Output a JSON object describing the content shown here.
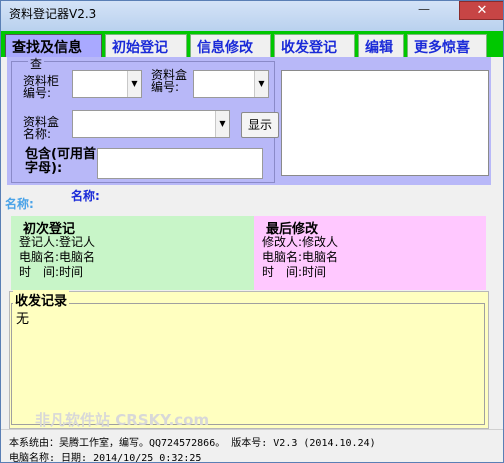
{
  "window": {
    "title": "资料登记器V2.3",
    "min_glyph": "—",
    "close_glyph": "✕"
  },
  "tabs": [
    {
      "label": "查找及信息",
      "active": true
    },
    {
      "label": "初始登记",
      "active": false
    },
    {
      "label": "信息修改",
      "active": false
    },
    {
      "label": "收发登记",
      "active": false
    },
    {
      "label": "编辑",
      "active": false
    },
    {
      "label": "更多惊喜",
      "active": false
    }
  ],
  "query": {
    "legend": "查",
    "cabinet_label_1": "资料柜",
    "cabinet_label_2": "编号:",
    "box_no_label_1": "资料盒",
    "box_no_label_2": "编号:",
    "box_name_label_1": "资料盒",
    "box_name_label_2": "名称:",
    "show_button": "显示",
    "keyword_label": "包含(可用首字母):",
    "keyword_value": ""
  },
  "name_label": "名称:",
  "name_label_left": "名称:",
  "first_registration": {
    "title": "初次登记",
    "registrar": "登记人:登记人",
    "computer": "电脑名:电脑名",
    "time": "时　间:时间"
  },
  "last_modification": {
    "title": "最后修改",
    "modifier": "修改人:修改人",
    "computer": "电脑名:电脑名",
    "time": "时　间:时间"
  },
  "log": {
    "title": "收发记录",
    "content": "无"
  },
  "status": {
    "line1": "本系统由：吴腾工作室，编写。QQ724572866。      版本号: V2.3   (2014.10.24)",
    "line2": "电脑名称:                          日期:        2014/10/25 0:32:25"
  },
  "watermark": "非凡软件站 CRSKY.com",
  "colors": {
    "tab_strip": "#00c800",
    "query_panel": "#b8b8f8",
    "first_reg_bg": "#c8f5c8",
    "last_mod_bg": "#ffc8ff",
    "log_bg": "#ffffc0",
    "tab_text": "#1a2ad8"
  }
}
